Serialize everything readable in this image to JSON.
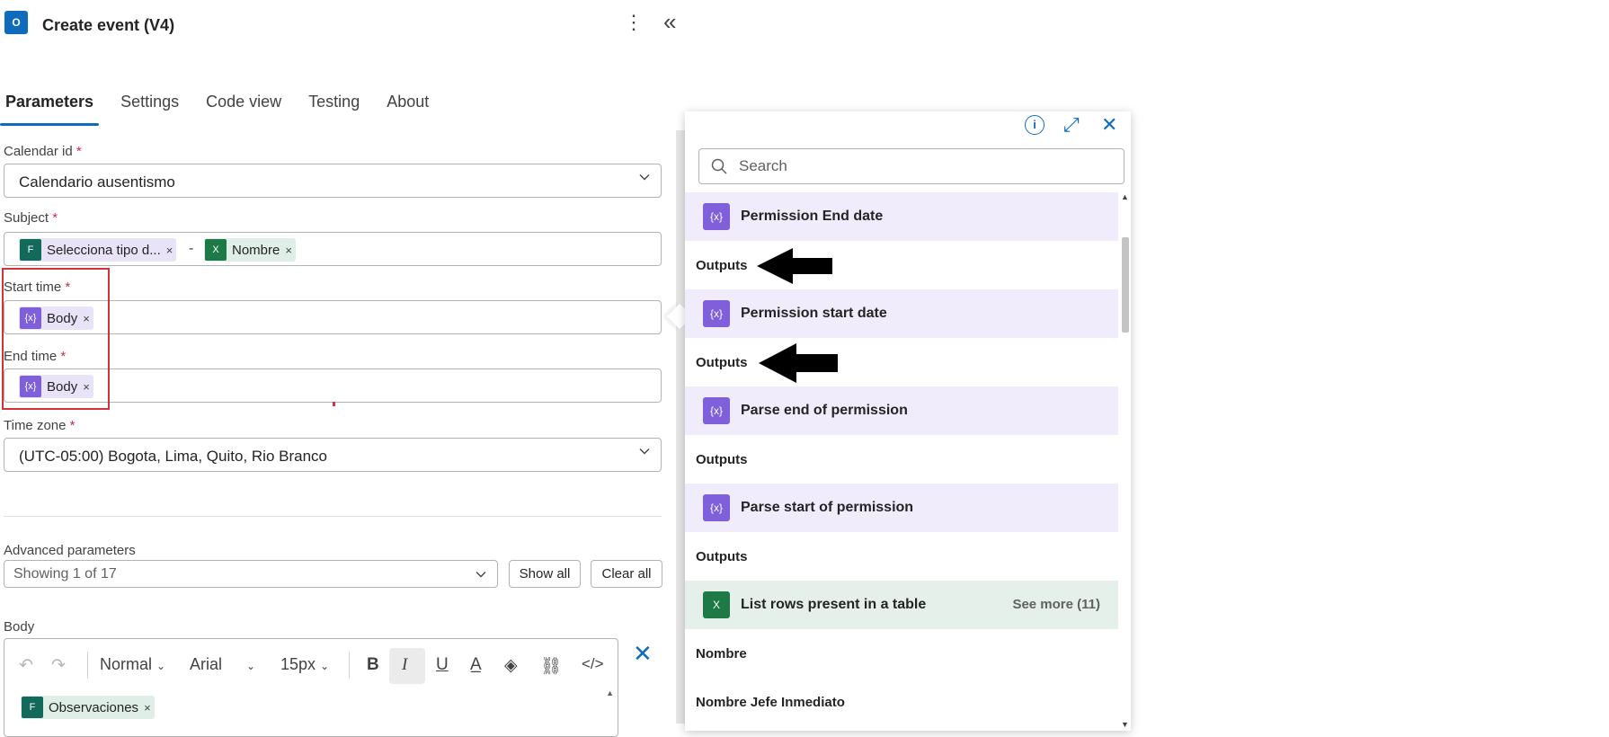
{
  "header": {
    "title": "Create event (V4)",
    "app_icon": "outlook-icon",
    "more_icon": "more-vertical-icon",
    "collapse_icon": "double-chevron-left-icon"
  },
  "tabs": [
    {
      "label": "Parameters",
      "active": true
    },
    {
      "label": "Settings",
      "active": false
    },
    {
      "label": "Code view",
      "active": false
    },
    {
      "label": "Testing",
      "active": false
    },
    {
      "label": "About",
      "active": false
    }
  ],
  "fields": {
    "calendar": {
      "label": "Calendar id",
      "required": "*",
      "value": "Calendario ausentismo"
    },
    "subject": {
      "label": "Subject",
      "required": "*",
      "token1": "Selecciona tipo d...",
      "separator": "-",
      "token2": "Nombre"
    },
    "start_time": {
      "label": "Start time",
      "required": "*",
      "token": "Body"
    },
    "end_time": {
      "label": "End time",
      "required": "*",
      "token": "Body"
    },
    "time_zone": {
      "label": "Time zone",
      "required": "*",
      "value": "(UTC-05:00) Bogota, Lima, Quito, Rio Branco"
    }
  },
  "advanced": {
    "label": "Advanced parameters",
    "value": "Showing 1 of 17",
    "show_all": "Show all",
    "clear_all": "Clear all"
  },
  "body_editor": {
    "label": "Body",
    "format": "Normal",
    "font": "Arial",
    "size": "15px",
    "token": "Observaciones"
  },
  "panel": {
    "search_placeholder": "Search",
    "items": [
      {
        "type": "group",
        "label": "Permission End date"
      },
      {
        "type": "item",
        "label": "Outputs"
      },
      {
        "type": "group",
        "label": "Permission start date"
      },
      {
        "type": "item",
        "label": "Outputs"
      },
      {
        "type": "group",
        "label": "Parse end of permission"
      },
      {
        "type": "item",
        "label": "Outputs"
      },
      {
        "type": "group",
        "label": "Parse start of permission"
      },
      {
        "type": "item",
        "label": "Outputs"
      },
      {
        "type": "group-excel",
        "label": "List rows present in a table",
        "see_more": "See more (11)"
      },
      {
        "type": "item",
        "label": "Nombre"
      },
      {
        "type": "item",
        "label": "Nombre Jefe Inmediato"
      }
    ]
  },
  "colors": {
    "accent": "#0f6cbd",
    "token_purple": "#7f5fda",
    "excel_green": "#1d7a46",
    "highlight_red": "#d13438"
  }
}
